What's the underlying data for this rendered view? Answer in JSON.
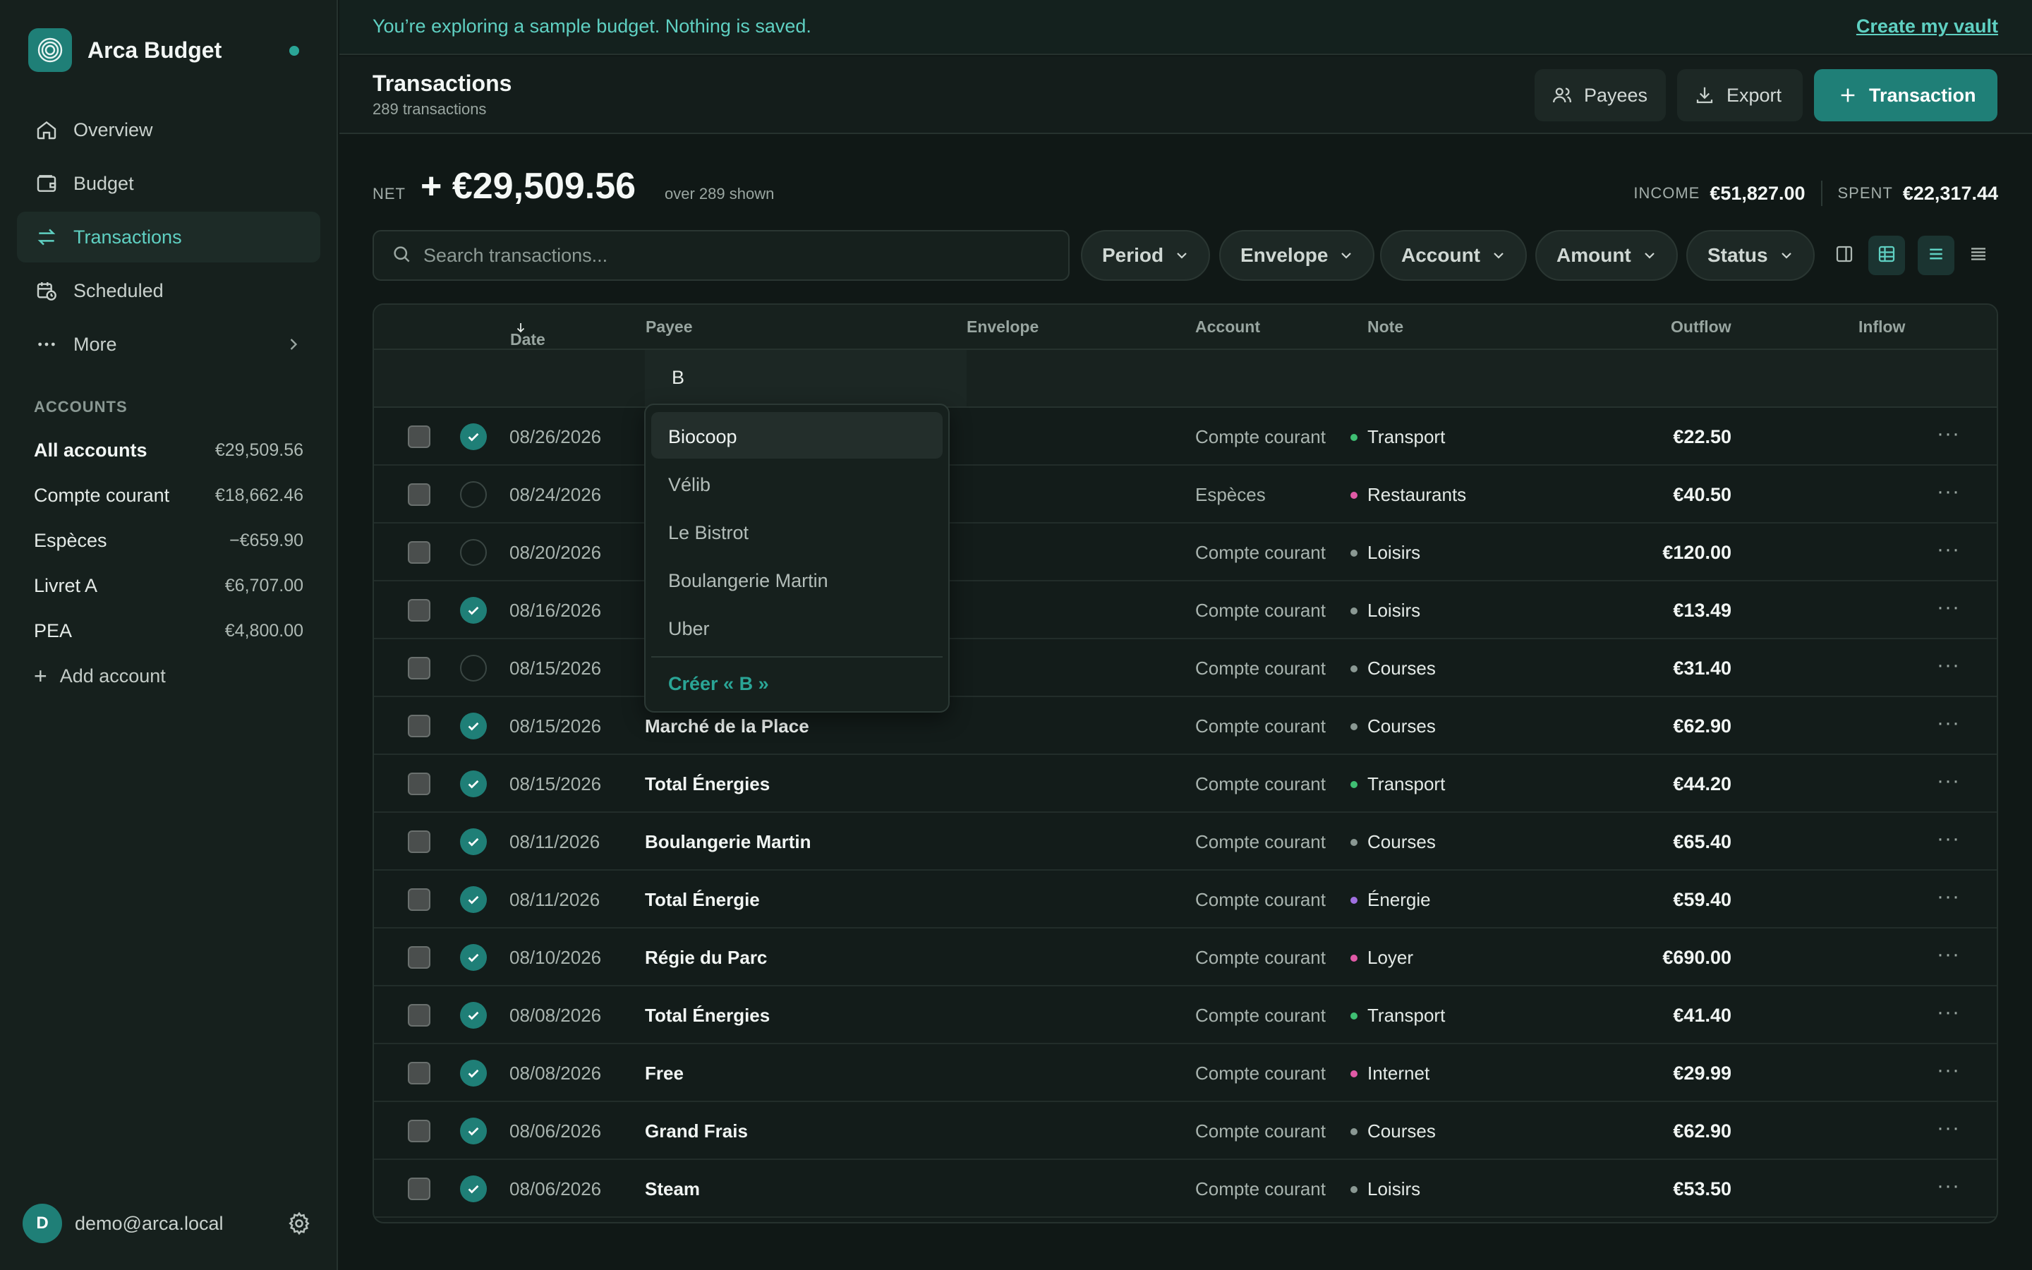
{
  "app": {
    "name": "Arca Budget"
  },
  "banner": {
    "text": "You’re exploring a sample budget. Nothing is saved.",
    "link": "Create my vault"
  },
  "sidebar": {
    "nav": [
      {
        "label": "Overview",
        "icon": "home-icon"
      },
      {
        "label": "Budget",
        "icon": "wallet-icon"
      },
      {
        "label": "Transactions",
        "icon": "arrows-swap-icon",
        "active": true
      },
      {
        "label": "Scheduled",
        "icon": "calendar-clock-icon"
      },
      {
        "label": "More",
        "icon": "dots-icon"
      }
    ],
    "accounts_heading": "ACCOUNTS",
    "accounts": [
      {
        "name": "All accounts",
        "amount": "€29,509.56"
      },
      {
        "name": "Compte courant",
        "amount": "€18,662.46"
      },
      {
        "name": "Espèces",
        "amount": "−€659.90"
      },
      {
        "name": "Livret A",
        "amount": "€6,707.00"
      },
      {
        "name": "PEA",
        "amount": "€4,800.00"
      }
    ],
    "add_account": "Add account",
    "user": {
      "initial": "D",
      "email": "demo@arca.local"
    }
  },
  "header": {
    "title": "Transactions",
    "subtitle": "289 transactions",
    "buttons": {
      "payees": "Payees",
      "export": "Export",
      "transaction": "Transaction"
    }
  },
  "summary": {
    "net_label": "NET",
    "net_value": "+ €29,509.56",
    "net_note": "over 289 shown",
    "income_label": "INCOME",
    "income_value": "€51,827.00",
    "spent_label": "SPENT",
    "spent_value": "€22,317.44"
  },
  "search": {
    "placeholder": "Search transactions..."
  },
  "filters": [
    "Period",
    "Envelope",
    "Account",
    "Amount",
    "Status"
  ],
  "table": {
    "columns": {
      "date": "Date",
      "payee": "Payee",
      "envelope": "Envelope",
      "account": "Account",
      "note": "Note",
      "outflow": "Outflow",
      "inflow": "Inflow"
    },
    "edit_value": "B",
    "rows": [
      {
        "date": "08/26/2026",
        "cleared": true,
        "payee": "",
        "envelope": "Transport",
        "account": "Compte courant",
        "outflow": "€22.50"
      },
      {
        "date": "08/24/2026",
        "cleared": false,
        "payee": "",
        "envelope": "Restaurants",
        "account": "Espèces",
        "outflow": "€40.50"
      },
      {
        "date": "08/20/2026",
        "cleared": false,
        "payee": "",
        "envelope": "Loisirs",
        "account": "Compte courant",
        "outflow": "€120.00"
      },
      {
        "date": "08/16/2026",
        "cleared": true,
        "payee": "",
        "envelope": "Loisirs",
        "account": "Compte courant",
        "outflow": "€13.49"
      },
      {
        "date": "08/15/2026",
        "cleared": false,
        "payee": "",
        "envelope": "Courses",
        "account": "Compte courant",
        "outflow": "€31.40"
      },
      {
        "date": "08/15/2026",
        "cleared": true,
        "payee": "Marché de la Place",
        "envelope": "Courses",
        "account": "Compte courant",
        "outflow": "€62.90"
      },
      {
        "date": "08/15/2026",
        "cleared": true,
        "payee": "Total Énergies",
        "envelope": "Transport",
        "account": "Compte courant",
        "outflow": "€44.20"
      },
      {
        "date": "08/11/2026",
        "cleared": true,
        "payee": "Boulangerie Martin",
        "envelope": "Courses",
        "account": "Compte courant",
        "outflow": "€65.40"
      },
      {
        "date": "08/11/2026",
        "cleared": true,
        "payee": "Total Énergie",
        "envelope": "Énergie",
        "account": "Compte courant",
        "outflow": "€59.40"
      },
      {
        "date": "08/10/2026",
        "cleared": true,
        "payee": "Régie du Parc",
        "envelope": "Loyer",
        "account": "Compte courant",
        "outflow": "€690.00"
      },
      {
        "date": "08/08/2026",
        "cleared": true,
        "payee": "Total Énergies",
        "envelope": "Transport",
        "account": "Compte courant",
        "outflow": "€41.40"
      },
      {
        "date": "08/08/2026",
        "cleared": true,
        "payee": "Free",
        "envelope": "Internet",
        "account": "Compte courant",
        "outflow": "€29.99"
      },
      {
        "date": "08/06/2026",
        "cleared": true,
        "payee": "Grand Frais",
        "envelope": "Courses",
        "account": "Compte courant",
        "outflow": "€62.90"
      },
      {
        "date": "08/06/2026",
        "cleared": true,
        "payee": "Steam",
        "envelope": "Loisirs",
        "account": "Compte courant",
        "outflow": "€53.50"
      }
    ]
  },
  "envelope_colors": {
    "Transport": "#3fbf73",
    "Restaurants": "#e05aa6",
    "Loisirs": "#8a9893",
    "Courses": "#8a9893",
    "Énergie": "#a070e0",
    "Loyer": "#e05aa6",
    "Internet": "#e05aa6"
  },
  "dropdown": {
    "items": [
      "Biocoop",
      "Vélib",
      "Le Bistrot",
      "Boulangerie Martin",
      "Uber"
    ],
    "create": "Créer « B »"
  },
  "colors": {
    "accent": "#1f7f77",
    "accent_text": "#5fd0c2"
  }
}
